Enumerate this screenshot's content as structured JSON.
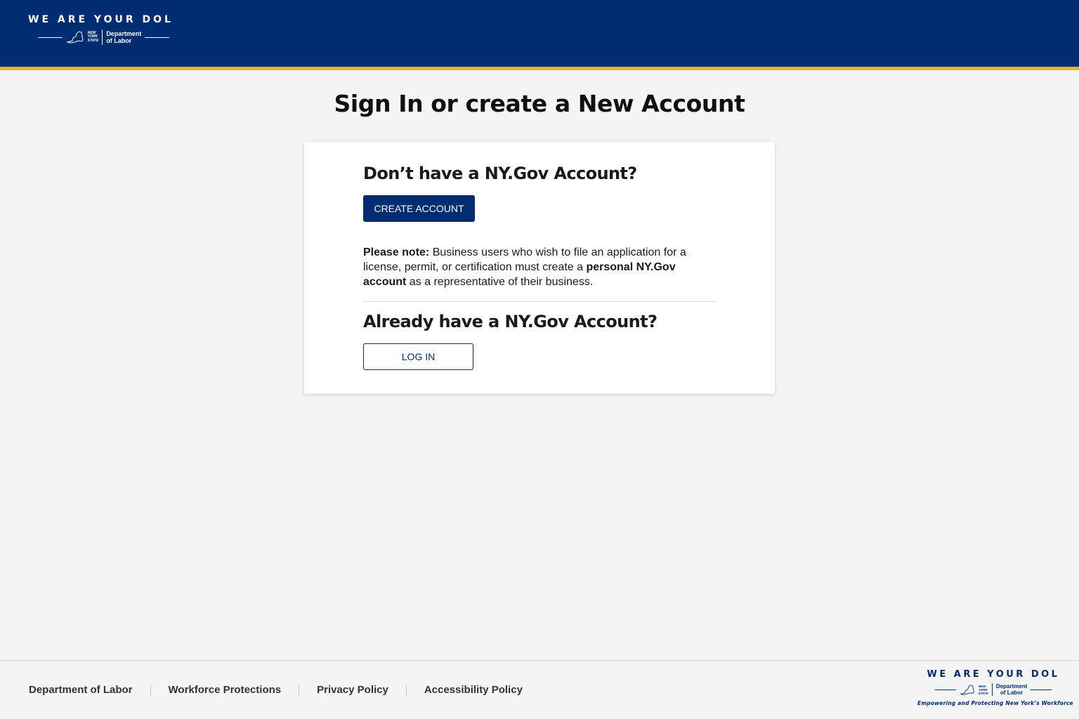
{
  "header": {
    "tagline": "WE ARE YOUR DOL",
    "logo": {
      "state_lines": [
        "NEW",
        "YORK",
        "STATE"
      ],
      "dept_lines": [
        "Department",
        "of Labor"
      ],
      "icon": "new-york-state-outline-icon"
    }
  },
  "page_title": "Sign In or create a New Account",
  "card": {
    "create_heading": "Don’t have a NY.Gov Account?",
    "create_button": "CREATE ACCOUNT",
    "note": {
      "label": "Please note:",
      "text1": " Business users who wish to file an application for a license, permit, or certification must create a ",
      "bold": "personal NY.Gov account",
      "text2": " as a representative of their business."
    },
    "login_heading": "Already have a NY.Gov Account?",
    "login_button": "LOG IN"
  },
  "footer": {
    "links": [
      "Department of Labor",
      "Workforce Protections",
      "Privacy Policy",
      "Accessibility Policy"
    ],
    "brand": {
      "tagline": "WE ARE YOUR DOL",
      "state_lines": [
        "NEW",
        "YORK",
        "STATE"
      ],
      "dept_lines": [
        "Department",
        "of Labor"
      ],
      "slogan": "Empowering and Protecting New York’s Workforce"
    }
  },
  "colors": {
    "header_bg": "#002d72",
    "accent_stripe": "#f2b41c",
    "primary_button": "#002d72",
    "page_bg": "#f4f4f4"
  }
}
